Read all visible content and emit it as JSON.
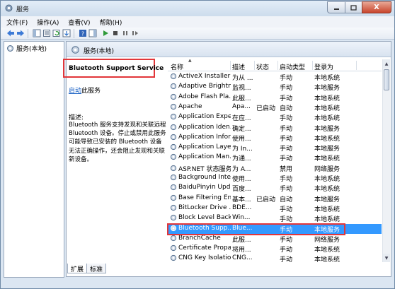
{
  "window": {
    "title": "服务",
    "controls": {
      "close": "X"
    }
  },
  "menu": [
    {
      "label": "文件(F)"
    },
    {
      "label": "操作(A)"
    },
    {
      "label": "查看(V)"
    },
    {
      "label": "帮助(H)"
    }
  ],
  "tree": {
    "root": "服务(本地)"
  },
  "pane_header": "服务(本地)",
  "details": {
    "service_name": "Bluetooth Support Service",
    "start_link": "启动",
    "start_suffix": "此服务",
    "desc_label": "描述:",
    "desc_text": "Bluetooth 服务支持发现和关联远程 Bluetooth 设备。停止或禁用此服务可能导致已安装的 Bluetooth 设备无法正确操作，还会阻止发现和关联新设备。"
  },
  "columns": {
    "name": "名称",
    "desc": "描述",
    "status": "状态",
    "startup": "启动类型",
    "logon": "登录为"
  },
  "services": [
    {
      "name": "ActiveX Installer ...",
      "desc": "为从 ...",
      "status": "",
      "startup": "手动",
      "logon": "本地系统"
    },
    {
      "name": "Adaptive Brightn...",
      "desc": "监视...",
      "status": "",
      "startup": "手动",
      "logon": "本地服务"
    },
    {
      "name": "Adobe Flash Pla...",
      "desc": "此服...",
      "status": "",
      "startup": "手动",
      "logon": "本地系统"
    },
    {
      "name": "Apache",
      "desc": "Apa...",
      "status": "已启动",
      "startup": "自动",
      "logon": "本地系统"
    },
    {
      "name": "Application Expe...",
      "desc": "在应...",
      "status": "",
      "startup": "手动",
      "logon": "本地系统"
    },
    {
      "name": "Application Iden...",
      "desc": "确定...",
      "status": "",
      "startup": "手动",
      "logon": "本地服务"
    },
    {
      "name": "Application Infor...",
      "desc": "使用...",
      "status": "",
      "startup": "手动",
      "logon": "本地系统"
    },
    {
      "name": "Application Layer ...",
      "desc": "为 In...",
      "status": "",
      "startup": "手动",
      "logon": "本地服务"
    },
    {
      "name": "Application Man...",
      "desc": "为通...",
      "status": "",
      "startup": "手动",
      "logon": "本地系统"
    },
    {
      "name": "ASP.NET 状态服务",
      "desc": "为 A...",
      "status": "",
      "startup": "禁用",
      "logon": "网络服务"
    },
    {
      "name": "Background Inte...",
      "desc": "使用...",
      "status": "",
      "startup": "手动",
      "logon": "本地系统"
    },
    {
      "name": "BaiduPinyin Upd...",
      "desc": "百度...",
      "status": "",
      "startup": "手动",
      "logon": "本地系统"
    },
    {
      "name": "Base Filtering En...",
      "desc": "基本...",
      "status": "已启动",
      "startup": "自动",
      "logon": "本地服务"
    },
    {
      "name": "BitLocker Drive ...",
      "desc": "BDE...",
      "status": "",
      "startup": "手动",
      "logon": "本地系统"
    },
    {
      "name": "Block Level Back...",
      "desc": "Win...",
      "status": "",
      "startup": "手动",
      "logon": "本地系统"
    },
    {
      "name": "Bluetooth Supp...",
      "desc": "Blue...",
      "status": "",
      "startup": "手动",
      "logon": "本地服务",
      "selected": true
    },
    {
      "name": "BranchCache",
      "desc": "此服...",
      "status": "",
      "startup": "手动",
      "logon": "网络服务"
    },
    {
      "name": "Certificate Propa...",
      "desc": "将用...",
      "status": "",
      "startup": "手动",
      "logon": "本地系统"
    },
    {
      "name": "CNG Key Isolation",
      "desc": "CNG...",
      "status": "",
      "startup": "手动",
      "logon": "本地系统"
    }
  ],
  "tabs": [
    {
      "label": "扩展"
    },
    {
      "label": "标准"
    }
  ],
  "colors": {
    "selection": "#3399ff",
    "highlight_box": "#e2363a",
    "link": "#1b62c4"
  }
}
